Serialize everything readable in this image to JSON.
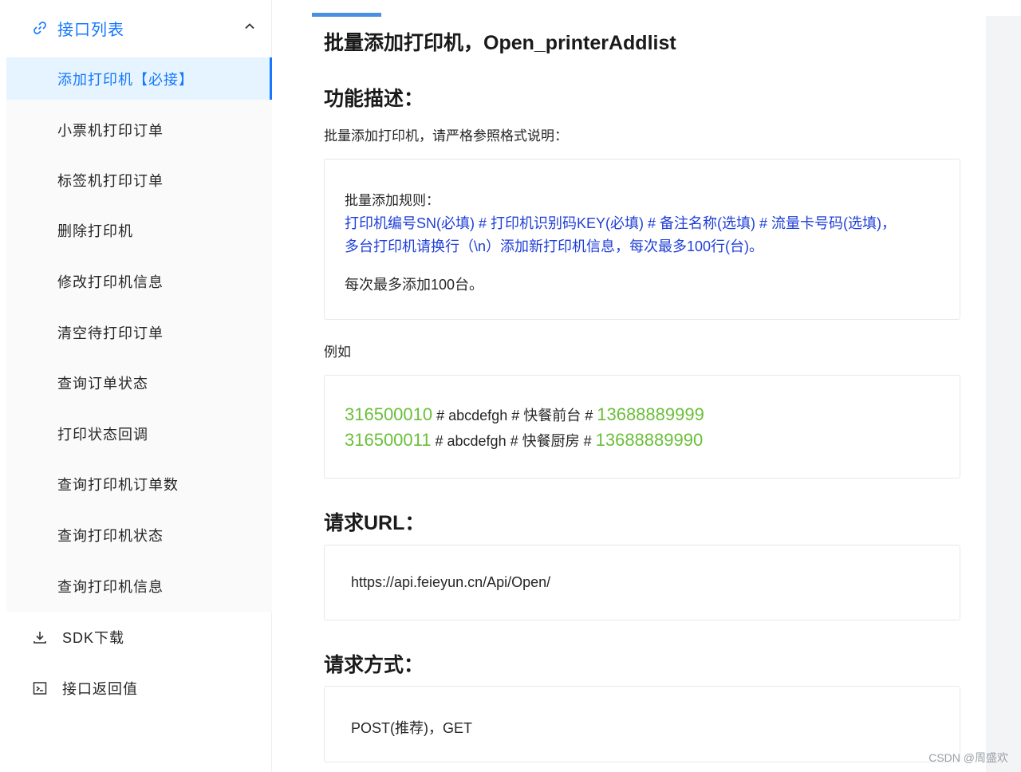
{
  "sidebar": {
    "group_label": "接口列表",
    "items": [
      {
        "label": "添加打印机【必接】",
        "active": true
      },
      {
        "label": "小票机打印订单"
      },
      {
        "label": "标签机打印订单"
      },
      {
        "label": "删除打印机"
      },
      {
        "label": "修改打印机信息"
      },
      {
        "label": "清空待打印订单"
      },
      {
        "label": "查询订单状态"
      },
      {
        "label": "打印状态回调"
      },
      {
        "label": "查询打印机订单数"
      },
      {
        "label": "查询打印机状态"
      },
      {
        "label": "查询打印机信息"
      }
    ],
    "sdk_label": "SDK下载",
    "return_label": "接口返回值"
  },
  "main": {
    "title": "批量添加打印机，Open_printerAddlist",
    "func_heading": "功能描述：",
    "func_desc": "批量添加打印机，请严格参照格式说明：",
    "rules": {
      "title": "批量添加规则：",
      "line1": "打印机编号SN(必填) # 打印机识别码KEY(必填) # 备注名称(选填) # 流量卡号码(选填)，",
      "line2": "多台打印机请换行（\\n）添加新打印机信息，每次最多100行(台)。",
      "note": "每次最多添加100台。"
    },
    "example_label": "例如",
    "example": [
      {
        "sn": "316500010",
        "mid": " # abcdefgh # 快餐前台 # ",
        "phone": "13688889999"
      },
      {
        "sn": "316500011",
        "mid": " # abcdefgh # 快餐厨房 # ",
        "phone": "13688889990"
      }
    ],
    "url_heading": "请求URL：",
    "url": "https://api.feieyun.cn/Api/Open/",
    "method_heading": "请求方式：",
    "method": "POST(推荐)，GET"
  },
  "watermark": "CSDN @周盛欢",
  "colors": {
    "accent": "#1677ff",
    "rule_text": "#1f3fd8",
    "example_number": "#6bbf3a"
  }
}
